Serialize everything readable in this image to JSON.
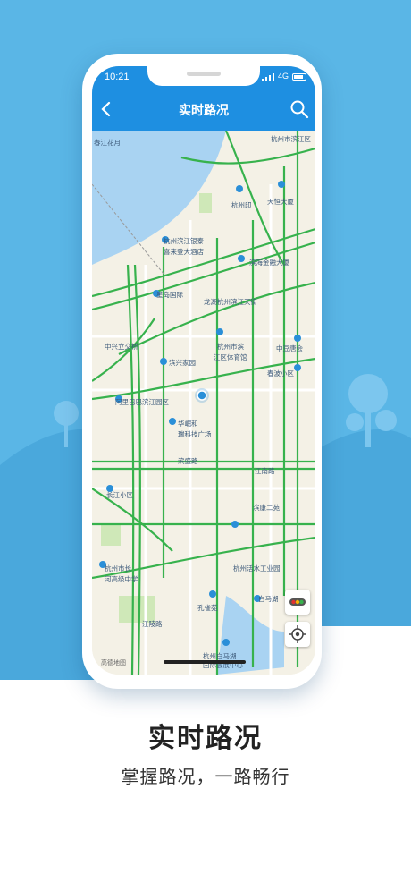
{
  "colors": {
    "sky": "#5ab6e6",
    "accent": "#1e8fe1",
    "road": "#37b24d",
    "water": "#a9d3f2"
  },
  "status_bar": {
    "time": "10:21",
    "network": "4G"
  },
  "nav": {
    "title": "实时路况",
    "back_icon": "chevron-left-icon",
    "search_icon": "search-icon"
  },
  "map": {
    "labels": [
      "杭州市滨江区",
      "春江花月",
      "杭州印",
      "天恒大厦",
      "滨海金融大厦",
      "杭州滨江银泰",
      "喜来登大酒店",
      "星岛国际",
      "龙湖杭州滨江天街",
      "中兴立交桥",
      "杭州市滨",
      "江区体育馆",
      "中豆唐会",
      "春波小区",
      "滨兴家园",
      "阿里巴巴滨江园区",
      "华崛和",
      "瑞科技广场",
      "长江小区",
      "江南路",
      "滨康二苑",
      "杭州活水工业园",
      "白马湖",
      "孔雀苑",
      "杭州市长",
      "河高级中学",
      "杭州白马湖",
      "国际会展中心",
      "江陵路",
      "滨盛路"
    ],
    "attribution": "高德地图"
  },
  "controls": {
    "traffic_icon": "traffic-light-icon",
    "locate_icon": "locate-icon"
  },
  "caption": {
    "title": "实时路况",
    "subtitle": "掌握路况，一路畅行"
  }
}
